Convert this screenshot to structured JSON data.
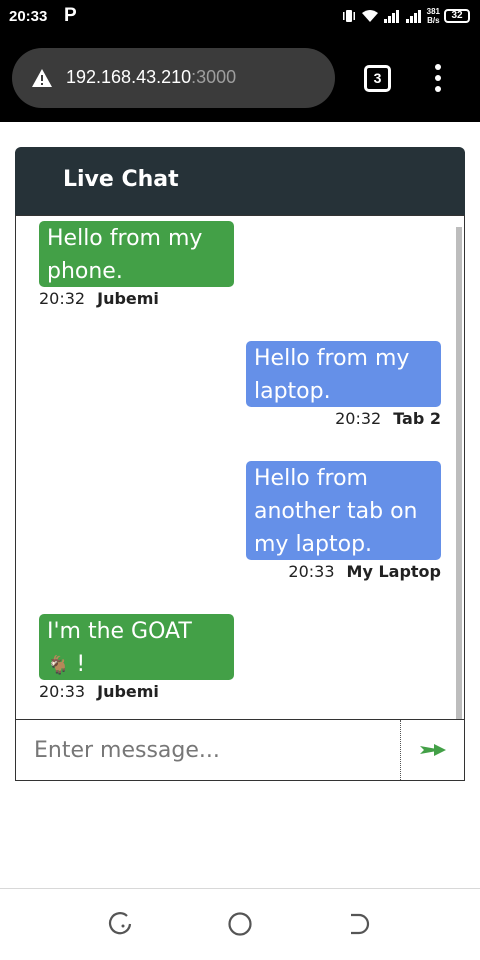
{
  "status_bar": {
    "time": "20:33",
    "notification_glyph": "P",
    "net_speed_value": "381",
    "net_speed_unit": "B/s",
    "battery": "32"
  },
  "browser": {
    "url_host": "192.168.43.210",
    "url_port": ":3000",
    "tab_count": "3",
    "warning_icon": "warning-triangle-icon",
    "menu_icon": "more-vert-icon"
  },
  "chat": {
    "title": "Live Chat",
    "messages": [
      {
        "side": "left",
        "text": "Hello from my phone.",
        "time": "20:32",
        "sender": "Jubemi"
      },
      {
        "side": "right",
        "text": "Hello from my laptop.",
        "time": "20:32",
        "sender": "Tab 2"
      },
      {
        "side": "right",
        "text": "Hello from another tab on my laptop.",
        "time": "20:33",
        "sender": "My Laptop"
      },
      {
        "side": "left",
        "text_before": "I'm the GOAT",
        "emoji": "🐐",
        "text_after": " !",
        "time": "20:33",
        "sender": "Jubemi"
      }
    ],
    "input_placeholder": "Enter message...",
    "send_icon": "send-arrow-icon"
  },
  "colors": {
    "header_bg": "#263238",
    "incoming_bubble": "#43a047",
    "outgoing_bubble": "#6590e8",
    "send_arrow": "#43a047"
  },
  "nav": {
    "back_icon": "recent-apps-icon",
    "home_icon": "home-circle-icon",
    "recents_icon": "back-icon"
  }
}
